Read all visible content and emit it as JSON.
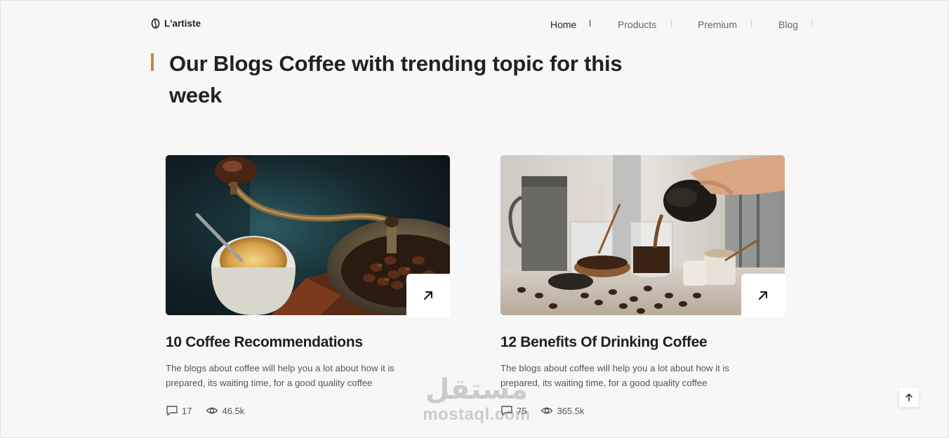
{
  "header": {
    "logo_text": "L'artiste",
    "logo_icon": "coffee-bean-icon",
    "nav": [
      {
        "label": "Home",
        "active": true
      },
      {
        "label": "Products",
        "active": false
      },
      {
        "label": "Premium",
        "active": false
      },
      {
        "label": "Blog",
        "active": false
      }
    ]
  },
  "section": {
    "title": "Our Blogs Coffee with trending topic for this week",
    "accent_color": "#c7893a"
  },
  "cards": [
    {
      "image": "coffee-grinder-photo",
      "title": "10 Coffee Recommendations",
      "description": "The blogs about coffee will help you a lot about how it is prepared, its waiting time, for a good quality coffee",
      "comments": "17",
      "views": "46.5k",
      "arrow_icon": "arrow-up-right-icon"
    },
    {
      "image": "coffee-pouring-photo",
      "title": "12 Benefits Of Drinking Coffee",
      "description": "The blogs about coffee will help you a lot about how it is prepared, its waiting time, for a good quality coffee",
      "comments": "75",
      "views": "365.5k",
      "arrow_icon": "arrow-up-right-icon"
    }
  ],
  "scroll_top_icon": "arrow-up-icon",
  "watermark": {
    "arabic": "مستقل",
    "latin": "mostaql.com"
  }
}
